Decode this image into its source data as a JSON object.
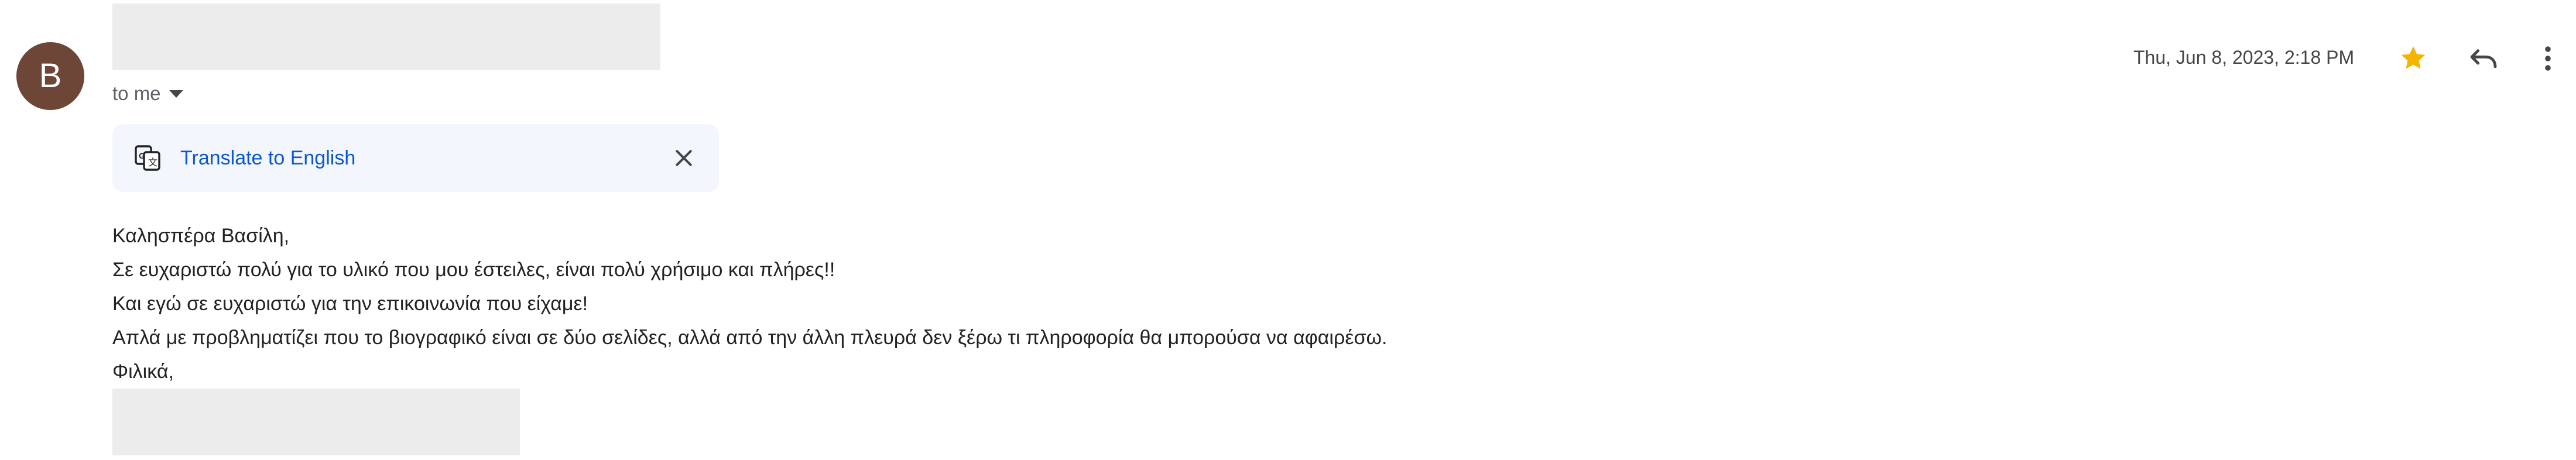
{
  "sender": {
    "avatar_letter": "B",
    "avatar_color": "#6d4638"
  },
  "recipient": {
    "label": "to me",
    "dropdown_icon": "caret-down-icon"
  },
  "translate_bar": {
    "icon": "translate-icon",
    "link_label": "Translate to English",
    "close_icon": "close-icon",
    "background_color": "#f3f6fc",
    "link_color": "#0b57d0"
  },
  "header_actions": {
    "date": "Thu, Jun 8, 2023, 2:18 PM",
    "star_icon": "star-icon",
    "star_color": "#f4b400",
    "reply_icon": "reply-icon",
    "more_icon": "more-vertical-icon"
  },
  "message": {
    "lines": [
      "Καλησπέρα Βασίλη,",
      "Σε ευχαριστώ πολύ για το υλικό που μου έστειλες, είναι πολύ χρήσιμο και πλήρες!!",
      "Και εγώ σε ευχαριστώ για την επικοινωνία που είχαμε!",
      "Απλά με προβληματίζει που το βιογραφικό είναι σε δύο σελίδες, αλλά από την άλλη πλευρά δεν ξέρω τι πληροφορία θα μπορούσα να αφαιρέσω.",
      "Φιλικά,"
    ]
  }
}
